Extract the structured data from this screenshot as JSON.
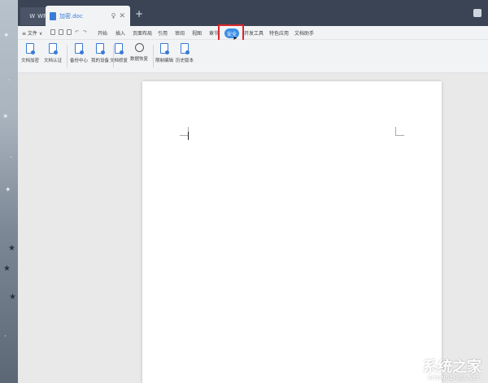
{
  "titlebar": {
    "app_tab": "WPS",
    "doc_tab": "加密.doc",
    "new_tab": "+"
  },
  "menubar": {
    "file": "≡ 文件 ∨",
    "items": [
      "开始",
      "插入",
      "页面布局",
      "引用",
      "审阅",
      "视图",
      "章节",
      "安全",
      "开发工具",
      "特色应用",
      "文档助手"
    ],
    "active": "安全"
  },
  "ribbon": {
    "buttons": [
      "文档加密",
      "文档认证",
      "备份中心",
      "我的设备",
      "文档修复",
      "数据恢复",
      "限制编辑",
      "历史版本"
    ]
  },
  "watermark": {
    "brand": "系统之家",
    "url": "XITONGZHIJIA.NET"
  },
  "colors": {
    "accent": "#3a8ee6",
    "highlight_box": "#d9262a",
    "titlebar": "#3b4454"
  }
}
